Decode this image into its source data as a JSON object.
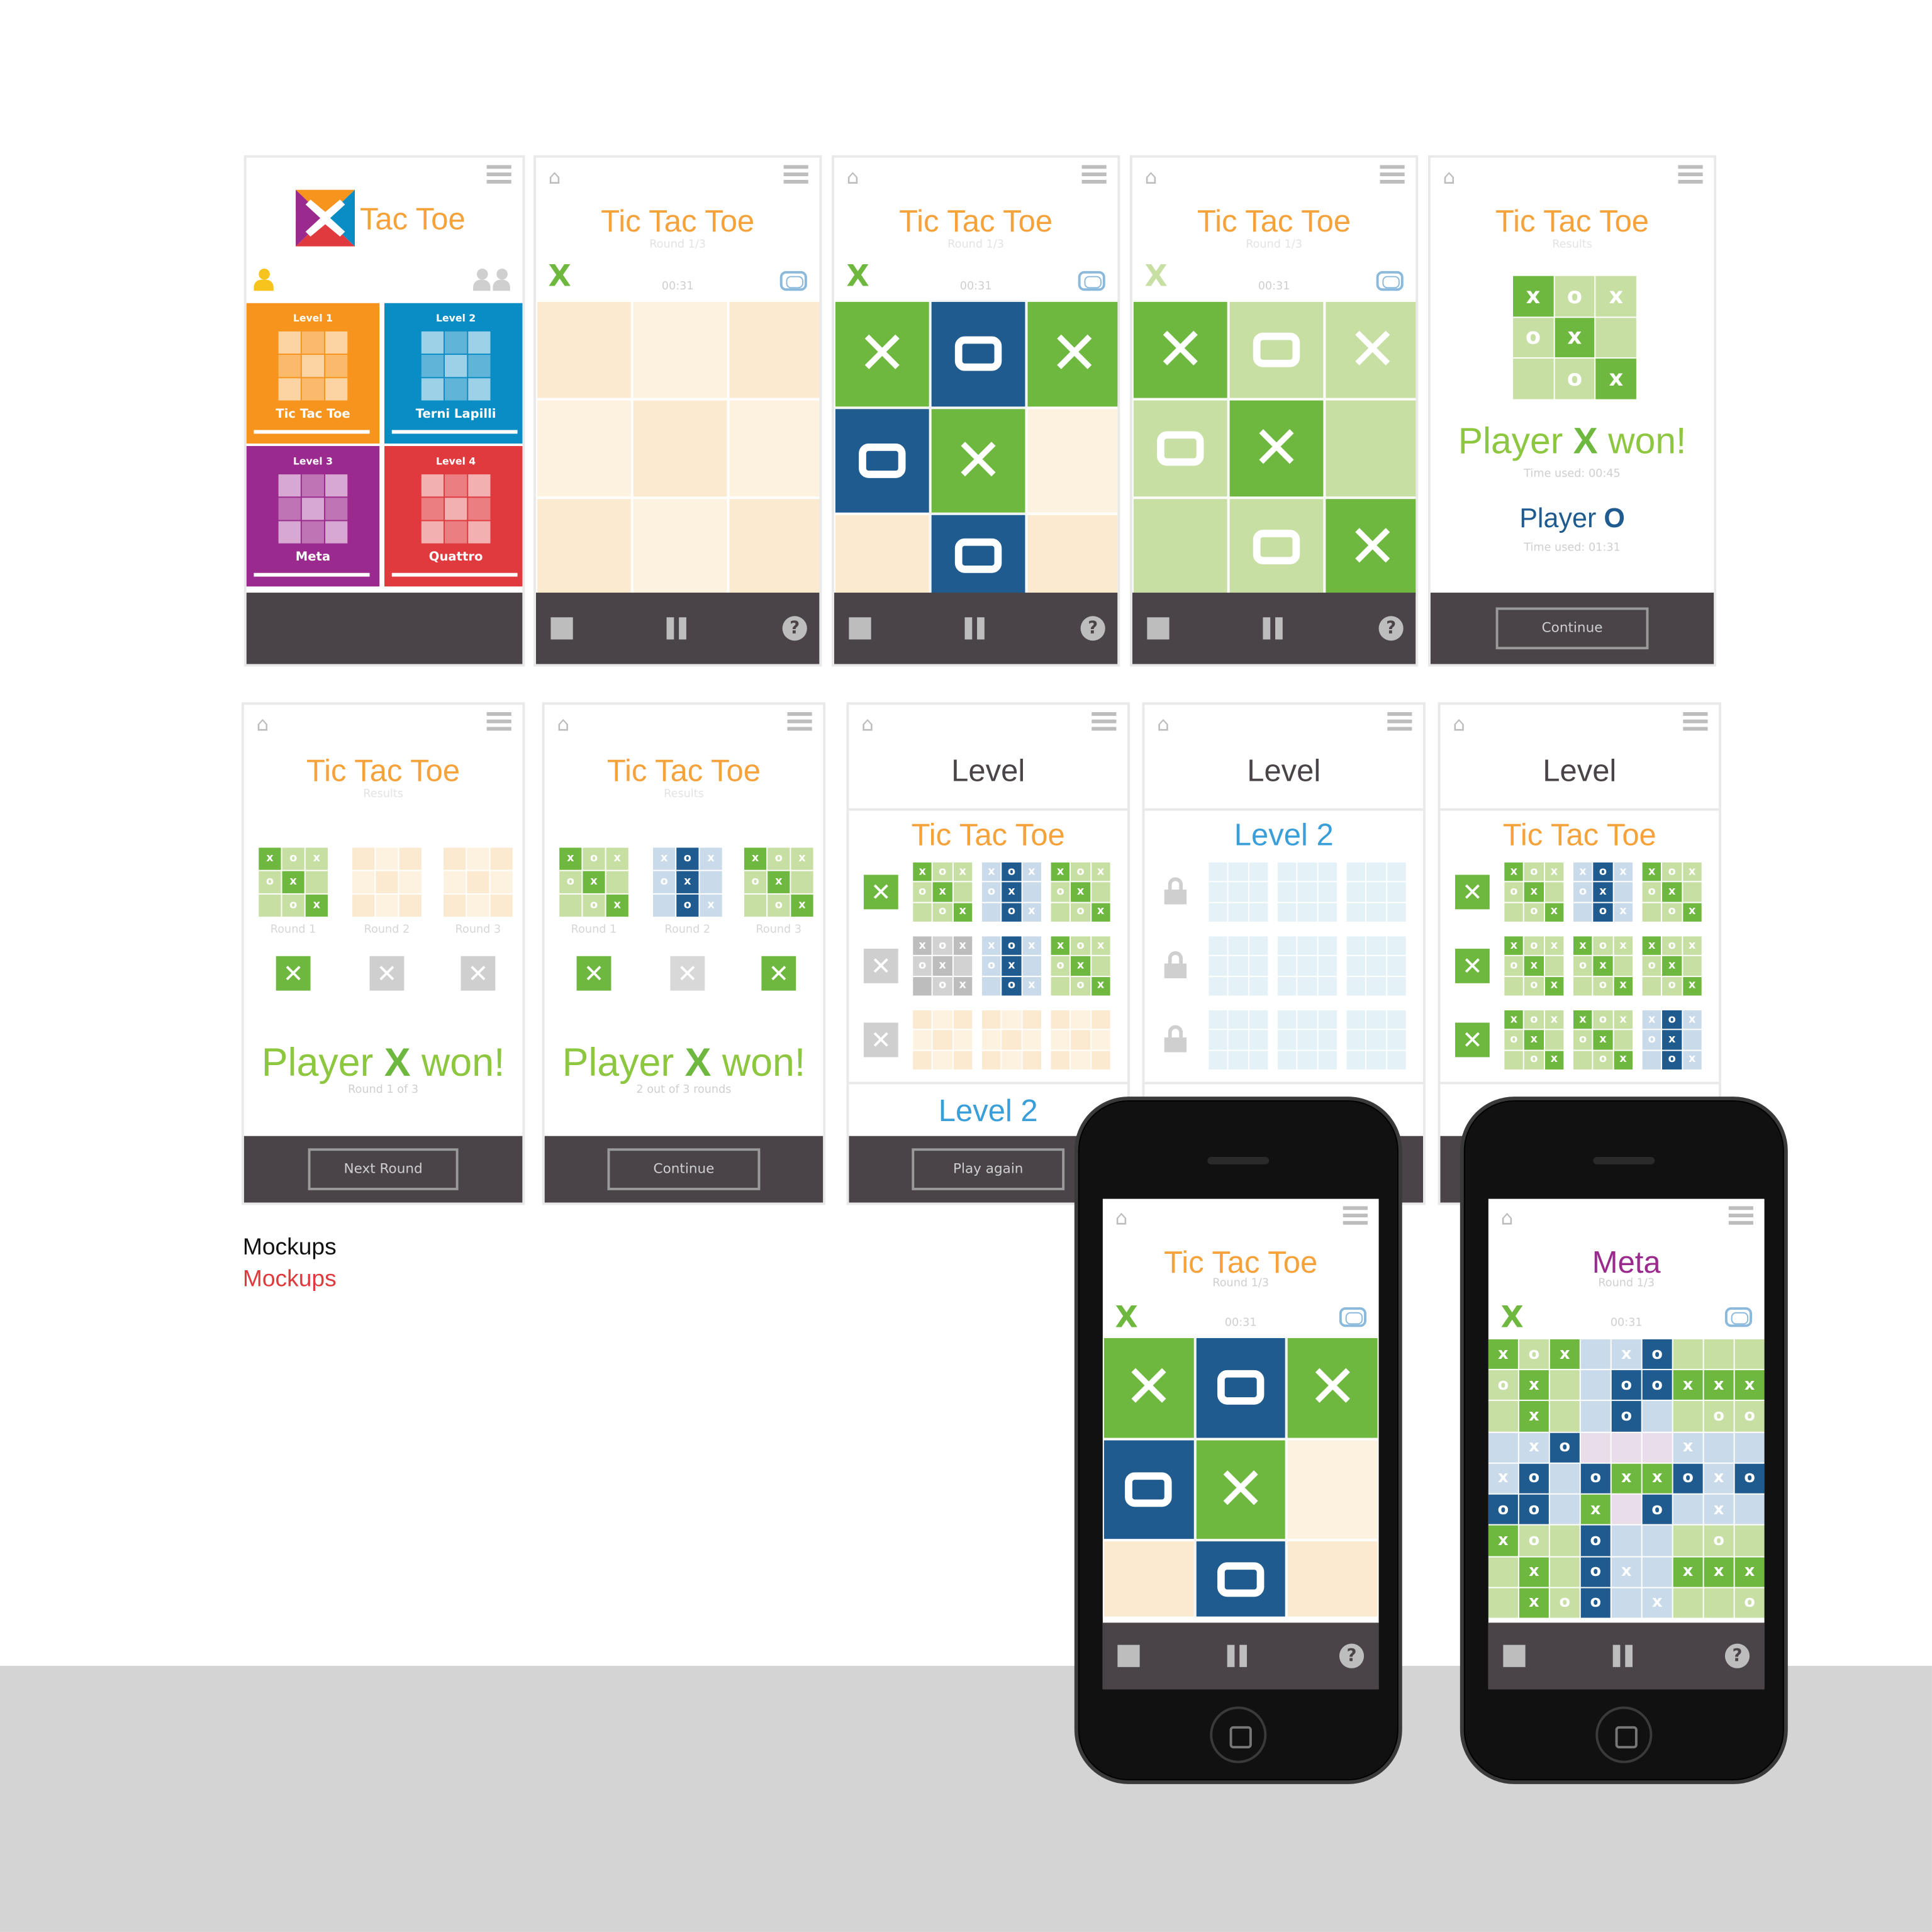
{
  "captions": {
    "line1": "Mockups",
    "line2": "Mockups"
  },
  "colors": {
    "accent_orange": "#f5a23b",
    "green": "#6fb83f",
    "light_green": "#c7dfa3",
    "blue": "#1f5b8e",
    "beige": "#fbe9d0",
    "dark_footer": "#4a4448",
    "level_blue": "#3a9ed9"
  },
  "icons": {
    "home": "home-icon",
    "menu": "hamburger-icon",
    "stop": "stop-icon",
    "pause": "pause-icon",
    "help": "help-icon",
    "camera": "camera-icon",
    "lock": "lock-icon",
    "person": "person-icon",
    "group": "group-icon"
  },
  "s1": {
    "logo_text": "Tac Toe",
    "tiles": [
      {
        "level": "Level 1",
        "name": "Tic Tac Toe",
        "color": "#f7941d"
      },
      {
        "level": "Level 2",
        "name": "Terni Lapilli",
        "color": "#0a8cc4"
      },
      {
        "level": "Level 3",
        "name": "Meta",
        "color": "#9b2a8e"
      },
      {
        "level": "Level 4",
        "name": "Quattro",
        "color": "#e03a3e"
      }
    ]
  },
  "s2": {
    "title": "Tic Tac Toe",
    "sub": "Round 1/3",
    "timer": "00:31",
    "player": "X"
  },
  "s3": {
    "title": "Tic Tac Toe",
    "sub": "Round 1/3",
    "timer": "00:31",
    "player": "X",
    "board": [
      "X",
      "O",
      "X",
      "O",
      "X",
      "",
      "",
      "O",
      ""
    ]
  },
  "s4": {
    "title": "Tic Tac Toe",
    "sub": "Round 1/3",
    "timer": "00:31",
    "player": "X",
    "board": [
      "X",
      "O",
      "X",
      "O",
      "X",
      "",
      "",
      "O",
      "X"
    ]
  },
  "s5": {
    "title": "Tic Tac Toe",
    "sub": "Results",
    "won_prefix": "Player",
    "won_mark": "X",
    "won_suffix": "won!",
    "time1": "Time used: 00:45",
    "player2": "Player",
    "player2_mark": "O",
    "time2": "Time used: 01:31",
    "button": "Continue",
    "mini": [
      "X",
      "O",
      "X",
      "O",
      "X",
      "",
      "",
      "O",
      "X"
    ]
  },
  "s6": {
    "title": "Tic Tac Toe",
    "sub": "Results",
    "rounds": [
      "Round 1",
      "Round 2",
      "Round 3"
    ],
    "won_prefix": "Player",
    "won_mark": "X",
    "won_suffix": "won!",
    "note": "Round 1 of 3",
    "button": "Next Round"
  },
  "s7": {
    "title": "Tic Tac Toe",
    "sub": "Results",
    "rounds": [
      "Round 1",
      "Round 2",
      "Round 3"
    ],
    "won_prefix": "Player",
    "won_mark": "X",
    "won_suffix": "won!",
    "note": "2 out of 3 rounds",
    "button": "Continue"
  },
  "s8": {
    "header": "Level",
    "title": "Tic Tac Toe",
    "next": "Level 2",
    "button": "Play again"
  },
  "s9": {
    "header": "Level",
    "title": "Level 2"
  },
  "s10": {
    "header": "Level",
    "title": "Tic Tac Toe"
  },
  "p1": {
    "title": "Tic Tac Toe",
    "sub": "Round 1/3",
    "timer": "00:31",
    "player": "X",
    "board": [
      "X",
      "O",
      "X",
      "O",
      "X",
      "",
      "",
      "O",
      ""
    ]
  },
  "p2": {
    "title": "Meta",
    "sub": "Round 1/3",
    "timer": "00:31",
    "player": "X"
  }
}
